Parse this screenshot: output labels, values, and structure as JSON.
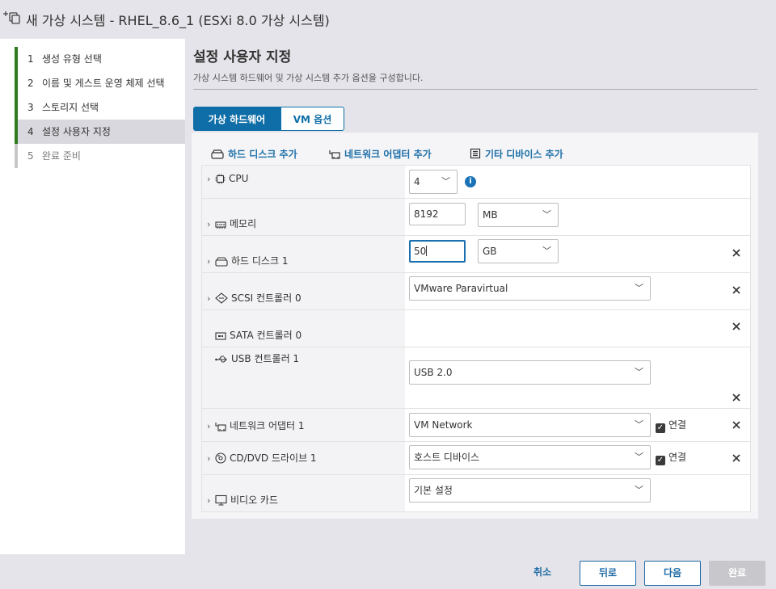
{
  "window": {
    "title": "새 가상 시스템 - RHEL_8.6_1 (ESXi 8.0 가상 시스템)"
  },
  "steps": [
    {
      "num": "1",
      "label": "생성 유형 선택"
    },
    {
      "num": "2",
      "label": "이름 및 게스트 운영 체제 선택"
    },
    {
      "num": "3",
      "label": "스토리지 선택"
    },
    {
      "num": "4",
      "label": "설정 사용자 지정"
    },
    {
      "num": "5",
      "label": "완료 준비"
    }
  ],
  "page": {
    "title": "설정 사용자 지정",
    "subtitle": "가상 시스템 하드웨어 및 가상 시스템 추가 옵션을 구성합니다."
  },
  "tabs": {
    "hardware": "가상 하드웨어",
    "vm_options": "VM 옵션"
  },
  "add": {
    "hard_disk": "하드 디스크 추가",
    "network_adapter": "네트워크 어댑터 추가",
    "other_device": "기타 디바이스 추가"
  },
  "hw": {
    "cpu": {
      "label": "CPU",
      "value": "4"
    },
    "memory": {
      "label": "메모리",
      "value": "8192",
      "unit": "MB"
    },
    "hard_disk": {
      "label": "하드 디스크 1",
      "value": "50",
      "unit": "GB"
    },
    "scsi": {
      "label": "SCSI 컨트롤러 0",
      "value": "VMware Paravirtual"
    },
    "sata": {
      "label": "SATA 컨트롤러 0"
    },
    "usb": {
      "label": "USB 컨트롤러 1",
      "value": "USB 2.0"
    },
    "network": {
      "label": "네트워크 어댑터 1",
      "value": "VM Network",
      "connect": "연결"
    },
    "cddvd": {
      "label": "CD/DVD 드라이브 1",
      "value": "호스트 디바이스",
      "connect": "연결"
    },
    "video": {
      "label": "비디오 카드",
      "value": "기본 설정"
    }
  },
  "footer": {
    "cancel": "취소",
    "back": "뒤로",
    "next": "다음",
    "finish": "완료"
  },
  "colors": {
    "accent": "#0f6ea7",
    "step_done": "#2d7a1f",
    "info": "#1a73b8"
  }
}
